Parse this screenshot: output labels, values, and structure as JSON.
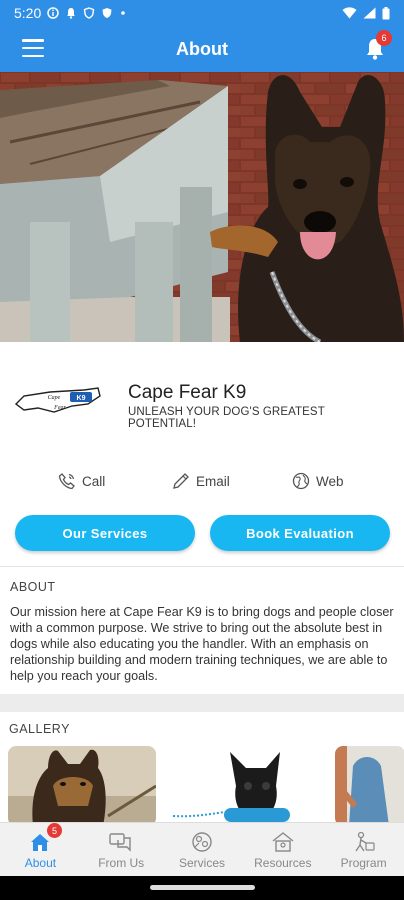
{
  "status_bar": {
    "time": "5:20"
  },
  "app_bar": {
    "title": "About",
    "notification_count": "6"
  },
  "brand": {
    "logo_text": "Cape Fear K9",
    "name": "Cape Fear K9",
    "tagline": "UNLEASH YOUR DOG'S GREATEST POTENTIAL!"
  },
  "contacts": {
    "call": "Call",
    "email": "Email",
    "web": "Web"
  },
  "buttons": {
    "services": "Our Services",
    "evaluation": "Book Evaluation"
  },
  "about": {
    "heading": "ABOUT",
    "text": "Our mission here at Cape Fear K9 is to bring dogs and people closer with a common purpose. We strive to bring out the absolute best in dogs while also educating you the handler. With an emphasis on relationship building and modern training techniques, we are able to help you reach your goals."
  },
  "gallery": {
    "heading": "GALLERY"
  },
  "bottom_nav": [
    {
      "label": "About",
      "badge": "5",
      "icon": "home-icon"
    },
    {
      "label": "From Us",
      "icon": "chat-icon"
    },
    {
      "label": "Services",
      "icon": "services-icon"
    },
    {
      "label": "Resources",
      "icon": "resources-icon"
    },
    {
      "label": "Program",
      "icon": "program-icon"
    }
  ],
  "colors": {
    "primary": "#2f8fe6",
    "button": "#18b7f2",
    "badge": "#e53935"
  }
}
